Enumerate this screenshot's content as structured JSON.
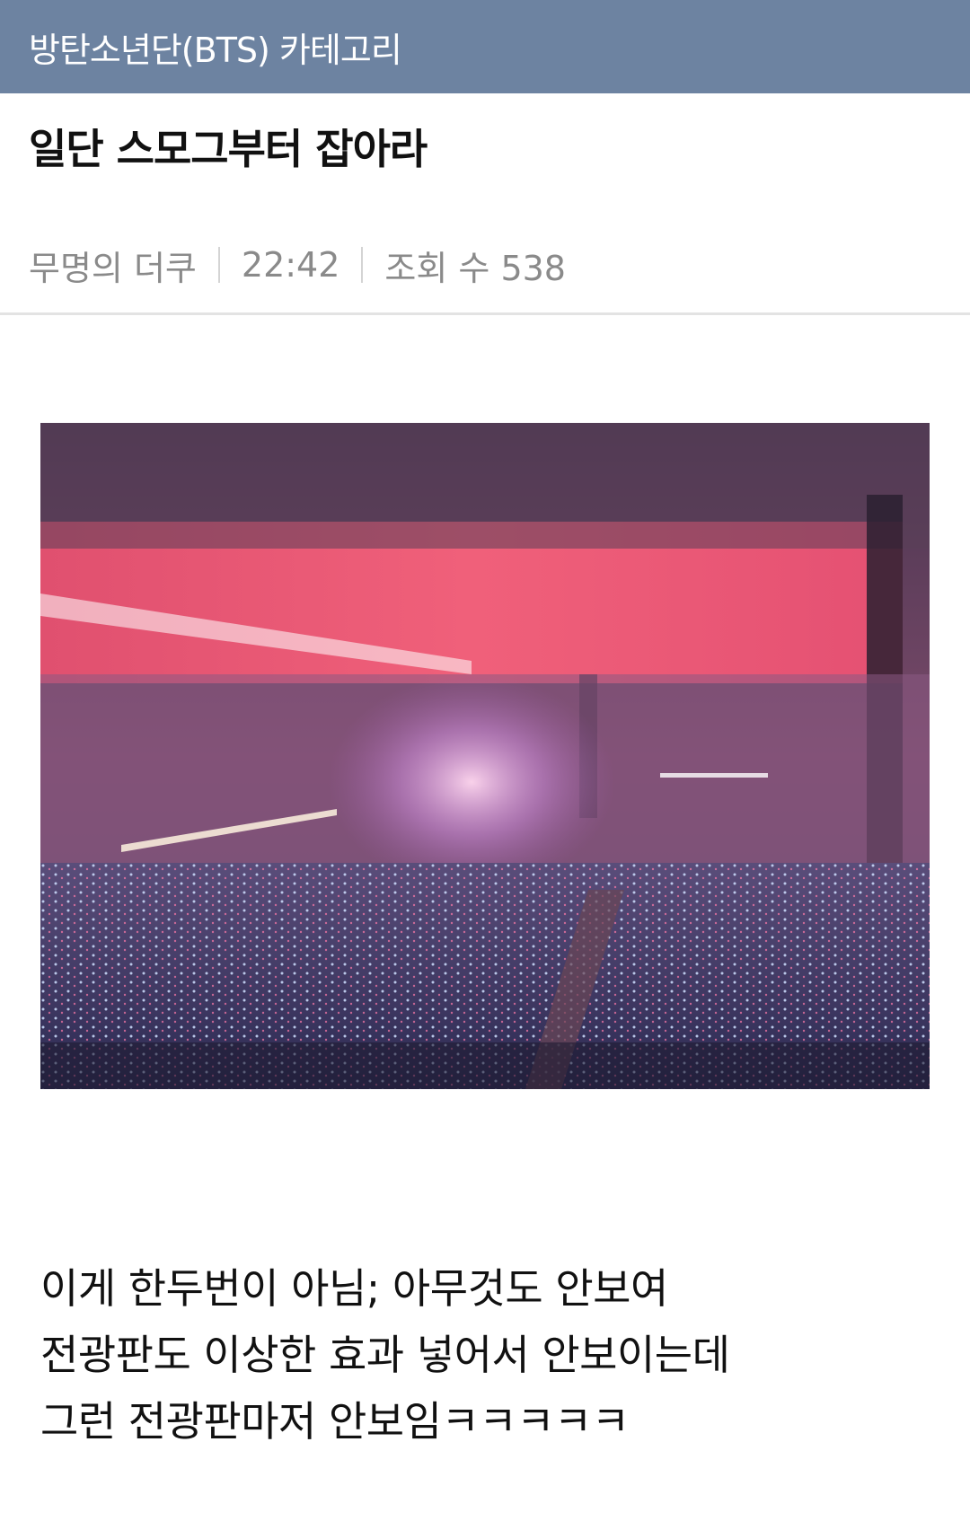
{
  "category": {
    "label": "방탄소년단(BTS) 카테고리"
  },
  "post": {
    "title": "일단 스모그부터 잡아라",
    "author": "무명의 더쿠",
    "time": "22:42",
    "views": "조회 수 538",
    "body_lines": [
      "이게 한두번이 아님; 아무것도 안보여",
      "전광판도 이상한 효과 넣어서 안보이는데",
      "그런 전광판마저 안보임ㅋㅋㅋㅋㅋ"
    ]
  },
  "colors": {
    "header_bg": "#6d83a1",
    "meta_text": "#8a8a8a",
    "divider": "#e3e3e3"
  }
}
